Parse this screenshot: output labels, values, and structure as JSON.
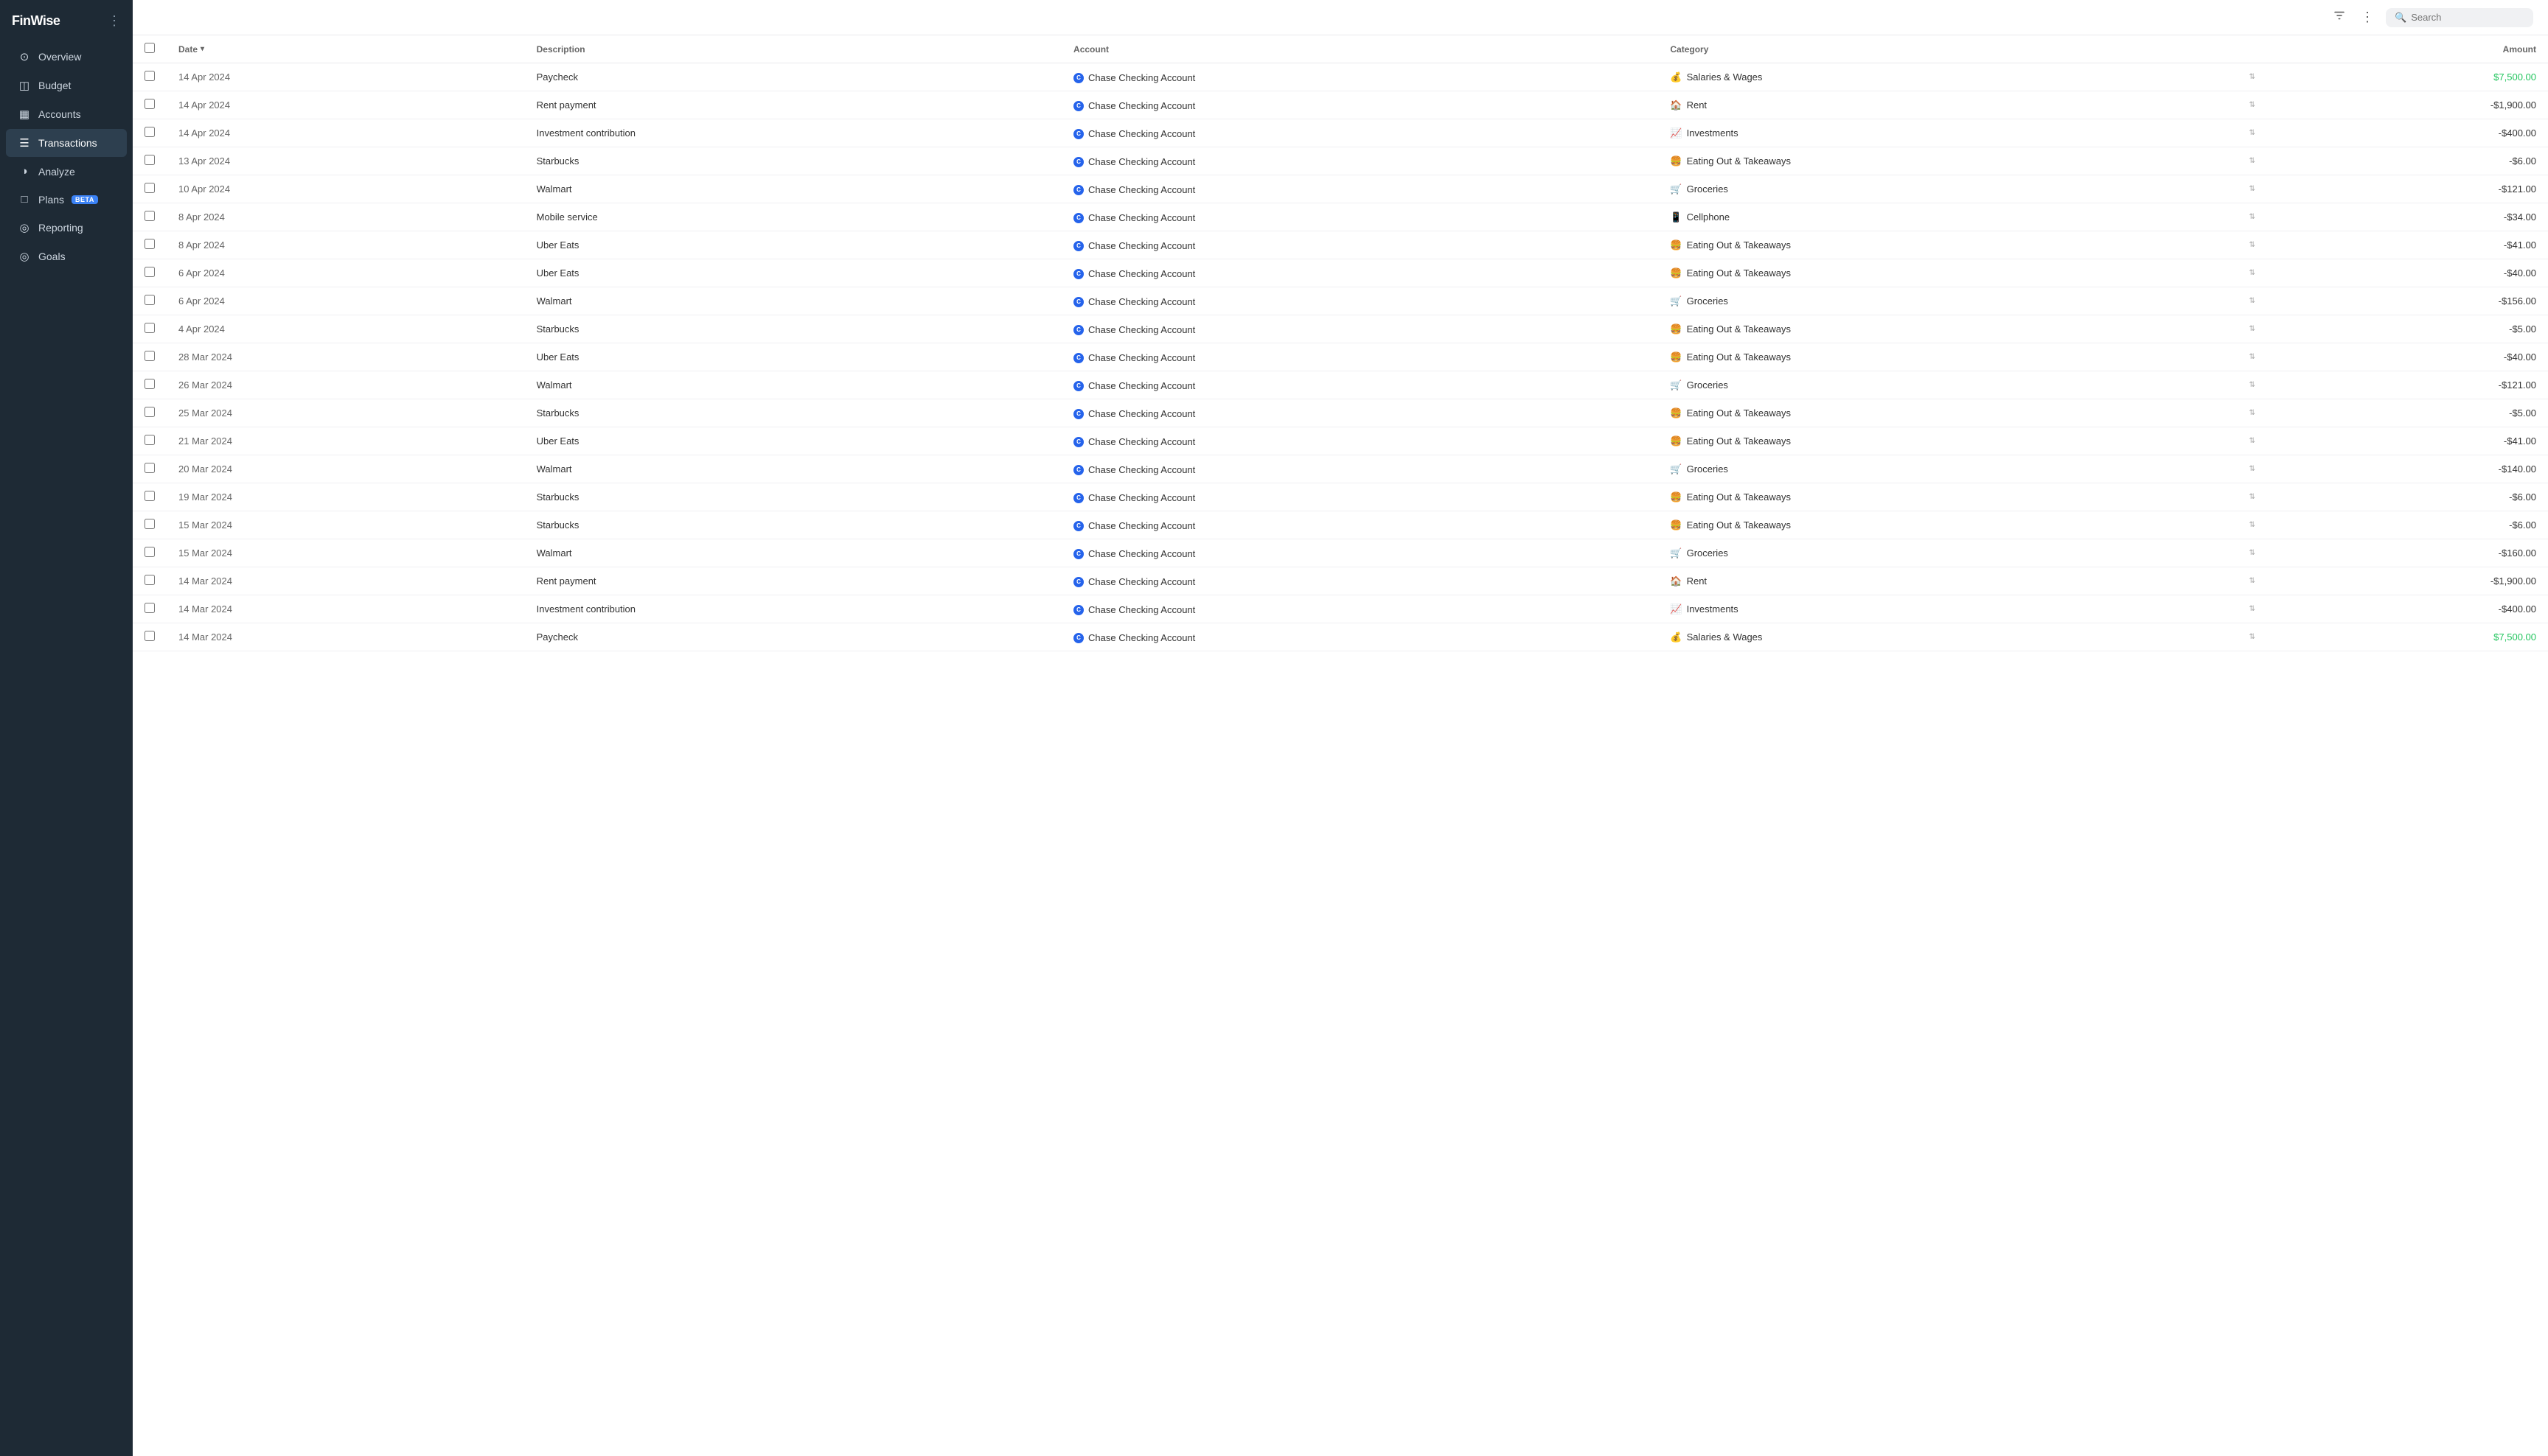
{
  "app": {
    "name": "FinWise"
  },
  "sidebar": {
    "menu_icon": "⋮",
    "items": [
      {
        "id": "overview",
        "label": "Overview",
        "icon": "⊙",
        "active": false
      },
      {
        "id": "budget",
        "label": "Budget",
        "icon": "◫",
        "active": false
      },
      {
        "id": "accounts",
        "label": "Accounts",
        "icon": "▦",
        "active": false
      },
      {
        "id": "transactions",
        "label": "Transactions",
        "icon": "☰",
        "active": true
      },
      {
        "id": "analyze",
        "label": "Analyze",
        "icon": "◑",
        "active": false
      },
      {
        "id": "plans",
        "label": "Plans",
        "icon": "□",
        "active": false,
        "badge": "BETA"
      },
      {
        "id": "reporting",
        "label": "Reporting",
        "icon": "◎",
        "active": false
      },
      {
        "id": "goals",
        "label": "Goals",
        "icon": "◎",
        "active": false
      }
    ]
  },
  "topbar": {
    "search_placeholder": "Search"
  },
  "table": {
    "columns": [
      {
        "id": "check",
        "label": ""
      },
      {
        "id": "date",
        "label": "Date",
        "sortable": true
      },
      {
        "id": "description",
        "label": "Description"
      },
      {
        "id": "account",
        "label": "Account"
      },
      {
        "id": "category",
        "label": "Category"
      },
      {
        "id": "amount",
        "label": "Amount",
        "align": "right"
      }
    ],
    "rows": [
      {
        "date": "14 Apr 2024",
        "description": "Paycheck",
        "account": "Chase Checking Account",
        "category_icon": "💰",
        "category": "Salaries & Wages",
        "amount": "$7,500.00",
        "positive": true
      },
      {
        "date": "14 Apr 2024",
        "description": "Rent payment",
        "account": "Chase Checking Account",
        "category_icon": "🏠",
        "category": "Rent",
        "amount": "-$1,900.00",
        "positive": false
      },
      {
        "date": "14 Apr 2024",
        "description": "Investment contribution",
        "account": "Chase Checking Account",
        "category_icon": "📈",
        "category": "Investments",
        "amount": "-$400.00",
        "positive": false
      },
      {
        "date": "13 Apr 2024",
        "description": "Starbucks",
        "account": "Chase Checking Account",
        "category_icon": "🍔",
        "category": "Eating Out & Takeaways",
        "amount": "-$6.00",
        "positive": false
      },
      {
        "date": "10 Apr 2024",
        "description": "Walmart",
        "account": "Chase Checking Account",
        "category_icon": "🛒",
        "category": "Groceries",
        "amount": "-$121.00",
        "positive": false
      },
      {
        "date": "8 Apr 2024",
        "description": "Mobile service",
        "account": "Chase Checking Account",
        "category_icon": "📱",
        "category": "Cellphone",
        "amount": "-$34.00",
        "positive": false
      },
      {
        "date": "8 Apr 2024",
        "description": "Uber Eats",
        "account": "Chase Checking Account",
        "category_icon": "🍔",
        "category": "Eating Out & Takeaways",
        "amount": "-$41.00",
        "positive": false
      },
      {
        "date": "6 Apr 2024",
        "description": "Uber Eats",
        "account": "Chase Checking Account",
        "category_icon": "🍔",
        "category": "Eating Out & Takeaways",
        "amount": "-$40.00",
        "positive": false
      },
      {
        "date": "6 Apr 2024",
        "description": "Walmart",
        "account": "Chase Checking Account",
        "category_icon": "🛒",
        "category": "Groceries",
        "amount": "-$156.00",
        "positive": false
      },
      {
        "date": "4 Apr 2024",
        "description": "Starbucks",
        "account": "Chase Checking Account",
        "category_icon": "🍔",
        "category": "Eating Out & Takeaways",
        "amount": "-$5.00",
        "positive": false
      },
      {
        "date": "28 Mar 2024",
        "description": "Uber Eats",
        "account": "Chase Checking Account",
        "category_icon": "🍔",
        "category": "Eating Out & Takeaways",
        "amount": "-$40.00",
        "positive": false
      },
      {
        "date": "26 Mar 2024",
        "description": "Walmart",
        "account": "Chase Checking Account",
        "category_icon": "🛒",
        "category": "Groceries",
        "amount": "-$121.00",
        "positive": false
      },
      {
        "date": "25 Mar 2024",
        "description": "Starbucks",
        "account": "Chase Checking Account",
        "category_icon": "🍔",
        "category": "Eating Out & Takeaways",
        "amount": "-$5.00",
        "positive": false
      },
      {
        "date": "21 Mar 2024",
        "description": "Uber Eats",
        "account": "Chase Checking Account",
        "category_icon": "🍔",
        "category": "Eating Out & Takeaways",
        "amount": "-$41.00",
        "positive": false
      },
      {
        "date": "20 Mar 2024",
        "description": "Walmart",
        "account": "Chase Checking Account",
        "category_icon": "🛒",
        "category": "Groceries",
        "amount": "-$140.00",
        "positive": false
      },
      {
        "date": "19 Mar 2024",
        "description": "Starbucks",
        "account": "Chase Checking Account",
        "category_icon": "🍔",
        "category": "Eating Out & Takeaways",
        "amount": "-$6.00",
        "positive": false
      },
      {
        "date": "15 Mar 2024",
        "description": "Starbucks",
        "account": "Chase Checking Account",
        "category_icon": "🍔",
        "category": "Eating Out & Takeaways",
        "amount": "-$6.00",
        "positive": false
      },
      {
        "date": "15 Mar 2024",
        "description": "Walmart",
        "account": "Chase Checking Account",
        "category_icon": "🛒",
        "category": "Groceries",
        "amount": "-$160.00",
        "positive": false
      },
      {
        "date": "14 Mar 2024",
        "description": "Rent payment",
        "account": "Chase Checking Account",
        "category_icon": "🏠",
        "category": "Rent",
        "amount": "-$1,900.00",
        "positive": false
      },
      {
        "date": "14 Mar 2024",
        "description": "Investment contribution",
        "account": "Chase Checking Account",
        "category_icon": "📈",
        "category": "Investments",
        "amount": "-$400.00",
        "positive": false
      },
      {
        "date": "14 Mar 2024",
        "description": "Paycheck",
        "account": "Chase Checking Account",
        "category_icon": "💰",
        "category": "Salaries & Wages",
        "amount": "$7,500.00",
        "positive": true
      }
    ]
  }
}
